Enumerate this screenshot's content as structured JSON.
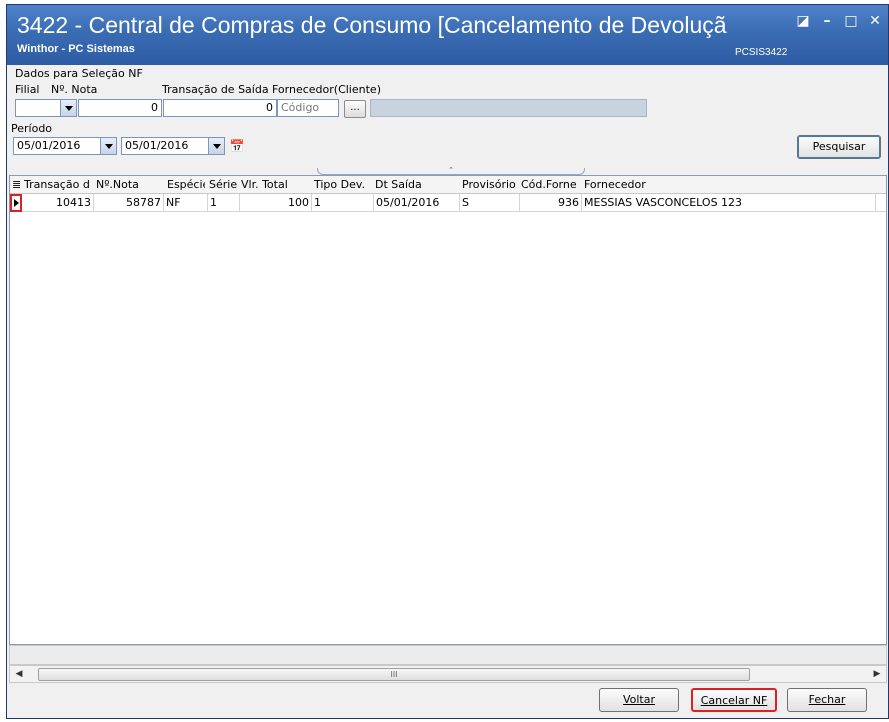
{
  "window": {
    "title": "3422 - Central de Compras de Consumo [Cancelamento de Devoluçã",
    "subtitle": "Winthor - PC Sistemas",
    "code": "PCSIS3422"
  },
  "filters": {
    "group_label": "Dados para Seleção NF",
    "filial_label": "Filial",
    "nota_label": "Nº. Nota",
    "nota_value": "0",
    "transacao_label": "Transação de Saída",
    "transacao_value": "0",
    "fornecedor_label": "Fornecedor(Cliente)",
    "fornecedor_placeholder": "Código",
    "lookup_label": "...",
    "periodo_label": "Período",
    "date_from": "05/01/2016",
    "date_to": "05/01/2016",
    "search_button": "Pesquisar"
  },
  "grid": {
    "columns": [
      "Transação d",
      "Nº.Nota",
      "Espécie",
      "Série",
      "Vlr. Total",
      "Tipo Dev.",
      "Dt Saída",
      "Provisório",
      "Cód.Forne",
      "Fornecedor"
    ],
    "rows": [
      [
        "10413",
        "58787",
        "NF",
        "1",
        "100",
        "1",
        "05/01/2016",
        "S",
        "936",
        "MESSIAS VASCONCELOS 123"
      ]
    ]
  },
  "scrollbar": {
    "grip": "III"
  },
  "buttons": {
    "voltar": "Voltar",
    "cancelar": "Cancelar NF",
    "fechar": "Fechar"
  }
}
